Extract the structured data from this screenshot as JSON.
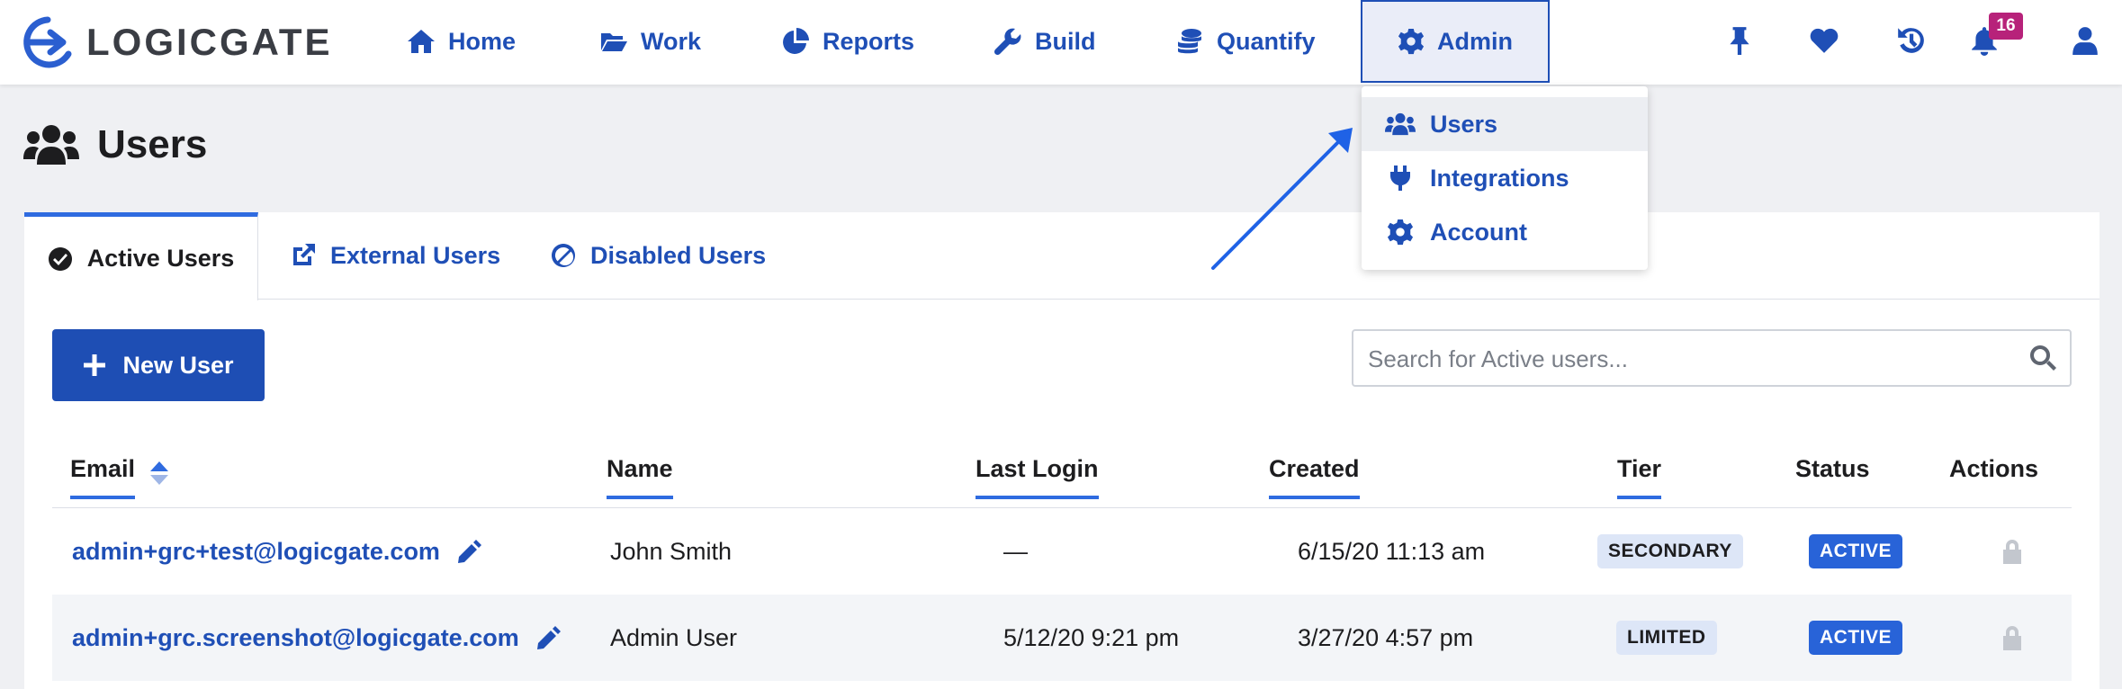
{
  "brand": {
    "name": "LOGICGATE",
    "accent": "#1f4fb6",
    "highlight": "#2f6be0",
    "badge_color": "#b7227a"
  },
  "nav": {
    "items": [
      {
        "label": "Home",
        "icon": "home-icon"
      },
      {
        "label": "Work",
        "icon": "folder-open-icon"
      },
      {
        "label": "Reports",
        "icon": "pie-chart-icon"
      },
      {
        "label": "Build",
        "icon": "wrench-icon"
      },
      {
        "label": "Quantify",
        "icon": "coins-icon"
      }
    ],
    "admin": {
      "label": "Admin",
      "icon": "gear-icon"
    },
    "utility_icons": [
      "pin-icon",
      "heart-icon",
      "history-icon",
      "bell-icon",
      "user-icon"
    ],
    "notification_count": "16"
  },
  "admin_menu": {
    "items": [
      {
        "label": "Users",
        "icon": "users-icon"
      },
      {
        "label": "Integrations",
        "icon": "plug-icon"
      },
      {
        "label": "Account",
        "icon": "gear-icon"
      }
    ]
  },
  "page": {
    "title": "Users"
  },
  "tabs": [
    {
      "label": "Active Users",
      "icon": "check-circle-icon"
    },
    {
      "label": "External Users",
      "icon": "external-link-icon"
    },
    {
      "label": "Disabled Users",
      "icon": "ban-icon"
    }
  ],
  "toolbar": {
    "new_user_label": "New User",
    "search_placeholder": "Search for Active users...",
    "search_value": ""
  },
  "table": {
    "columns": [
      "Email",
      "Name",
      "Last Login",
      "Created",
      "Tier",
      "Status",
      "Actions"
    ],
    "rows": [
      {
        "email": "admin+grc+test@logicgate.com",
        "name": "John Smith",
        "last_login": "—",
        "created": "6/15/20 11:13 am",
        "tier": "SECONDARY",
        "status": "ACTIVE"
      },
      {
        "email": "admin+grc.screenshot@logicgate.com",
        "name": "Admin User",
        "last_login": "5/12/20 9:21 pm",
        "created": "3/27/20 4:57 pm",
        "tier": "LIMITED",
        "status": "ACTIVE"
      }
    ]
  }
}
